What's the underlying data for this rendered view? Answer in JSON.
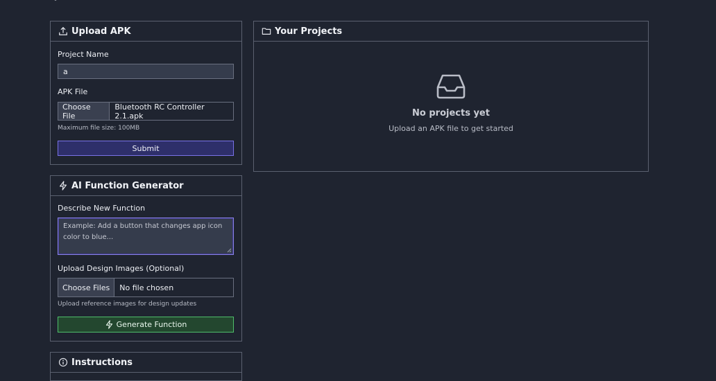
{
  "upload": {
    "title": "Upload APK",
    "project_name_label": "Project Name",
    "project_name_value": "a",
    "apk_file_label": "APK File",
    "choose_file": "Choose File",
    "file_name": "Bluetooth RC Controller 2.1.apk",
    "max_size": "Maximum file size: 100MB",
    "submit": "Submit"
  },
  "ai": {
    "title": "AI Function Generator",
    "describe_label": "Describe New Function",
    "describe_placeholder": "Example: Add a button that changes app icon color to blue...",
    "images_label": "Upload Design Images (Optional)",
    "choose_files": "Choose Files",
    "no_file": "No file chosen",
    "images_hint": "Upload reference images for design updates",
    "generate": "Generate Function"
  },
  "projects": {
    "title": "Your Projects",
    "empty_title": "No projects yet",
    "empty_subtitle": "Upload an APK file to get started"
  },
  "instructions": {
    "title": "Instructions"
  },
  "icons": {
    "upload": "upload-icon",
    "folder": "folder-icon",
    "zap": "zap-icon",
    "inbox": "inbox-icon",
    "info": "info-icon"
  },
  "colors": {
    "background": "#1f2430",
    "border": "#5b6170",
    "submit_accent": "#7a72e8",
    "generate_accent": "#4fbf6b"
  }
}
